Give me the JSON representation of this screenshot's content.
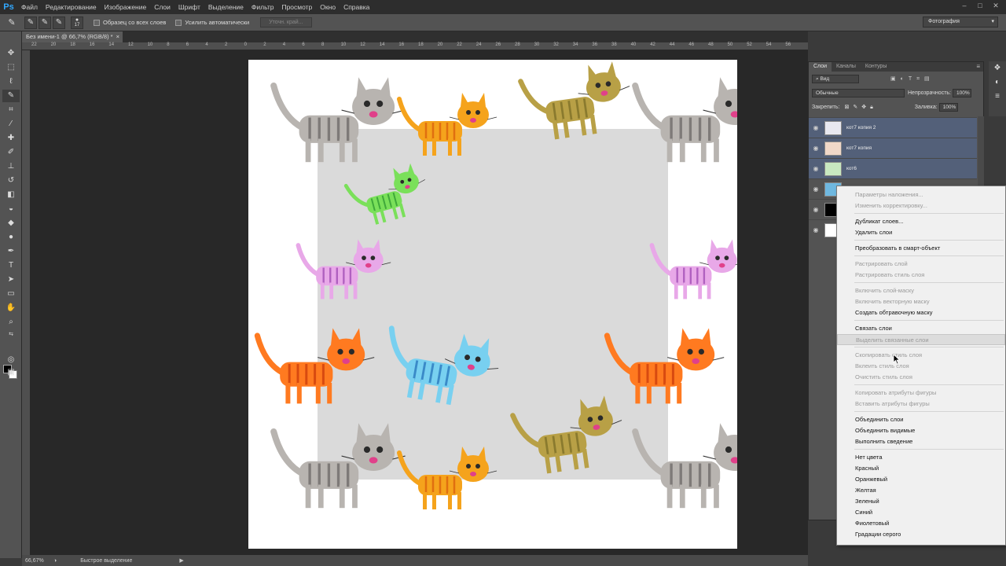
{
  "app": {
    "logo": "Ps"
  },
  "menu": [
    "Файл",
    "Редактирование",
    "Изображение",
    "Слои",
    "Шрифт",
    "Выделение",
    "Фильтр",
    "Просмотр",
    "Окно",
    "Справка"
  ],
  "options": {
    "brush_size": "17",
    "sample_all_layers": "Образец со всех слоев",
    "auto_enhance": "Усилить автоматически",
    "refine_edge": "Уточн. край..."
  },
  "workspace": "Фотография",
  "document_tab": "Без имени-1 @ 66,7% (RGB/8) *",
  "ruler_ticks": [
    "22",
    "20",
    "18",
    "16",
    "14",
    "12",
    "10",
    "8",
    "6",
    "4",
    "2",
    "0",
    "2",
    "4",
    "6",
    "8",
    "10",
    "12",
    "14",
    "16",
    "18",
    "20",
    "22",
    "24",
    "26",
    "28",
    "30",
    "32",
    "34",
    "36",
    "38",
    "40",
    "42",
    "44",
    "46",
    "48",
    "50",
    "52",
    "54",
    "56"
  ],
  "status": {
    "zoom": "66,67%",
    "info": "Быстрое выделение"
  },
  "layers_panel": {
    "tabs": [
      "Слои",
      "Каналы",
      "Контуры"
    ],
    "filter": "Вид",
    "blend_mode": "Обычные",
    "opacity_label": "Непрозрачность:",
    "opacity_value": "100%",
    "lock_label": "Закрепить:",
    "fill_label": "Заливка:",
    "fill_value": "100%",
    "layers": [
      {
        "name": "кот7 копия 2",
        "selected": true
      },
      {
        "name": "кот7 копия",
        "selected": true
      },
      {
        "name": "кот6",
        "selected": true
      },
      {
        "name": "",
        "selected": false
      },
      {
        "name": "",
        "selected": false
      },
      {
        "name": "",
        "selected": false
      }
    ]
  },
  "context_menu": [
    {
      "label": "Параметры наложения...",
      "enabled": false
    },
    {
      "label": "Изменить корректировку...",
      "enabled": false
    },
    {
      "label": "Дубликат слоев...",
      "enabled": true
    },
    {
      "label": "Удалить слои",
      "enabled": true
    },
    {
      "label": "Преобразовать в смарт-объект",
      "enabled": true
    },
    {
      "label": "Растрировать слой",
      "enabled": false
    },
    {
      "label": "Растрировать стиль слоя",
      "enabled": false
    },
    {
      "label": "Включить слой-маску",
      "enabled": false
    },
    {
      "label": "Включить векторную маску",
      "enabled": false
    },
    {
      "label": "Создать обтравочную маску",
      "enabled": true
    },
    {
      "label": "Связать слои",
      "enabled": true
    },
    {
      "label": "Выделить связанные слои",
      "enabled": false,
      "highlighted": true
    },
    {
      "label": "Скопировать стиль слоя",
      "enabled": false
    },
    {
      "label": "Вклеить стиль слоя",
      "enabled": false
    },
    {
      "label": "Очистить стиль слоя",
      "enabled": false
    },
    {
      "label": "Копировать атрибуты фигуры",
      "enabled": false
    },
    {
      "label": "Вставить атрибуты фигуры",
      "enabled": false
    },
    {
      "label": "Объединить слои",
      "enabled": true
    },
    {
      "label": "Объединить видимые",
      "enabled": true
    },
    {
      "label": "Выполнить сведение",
      "enabled": true
    },
    {
      "label": "Нет цвета",
      "enabled": true
    },
    {
      "label": "Красный",
      "enabled": true
    },
    {
      "label": "Оранжевый",
      "enabled": true
    },
    {
      "label": "Желтая",
      "enabled": true
    },
    {
      "label": "Зеленый",
      "enabled": true
    },
    {
      "label": "Синий",
      "enabled": true
    },
    {
      "label": "Фиолетовый",
      "enabled": true
    },
    {
      "label": "Градации серого",
      "enabled": true
    }
  ],
  "colors": {
    "foreground": "#000000",
    "background": "#ffffff",
    "selection": "#536079",
    "accent": "#31a8ff"
  }
}
